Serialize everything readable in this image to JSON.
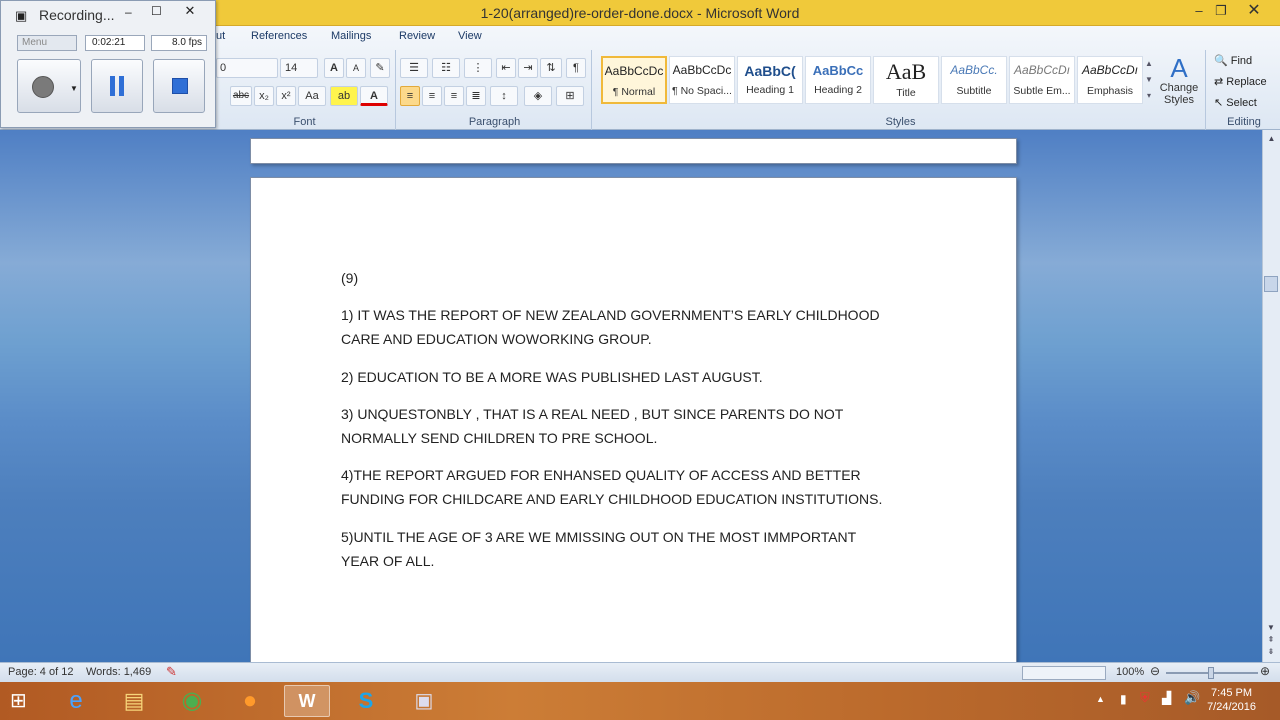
{
  "window": {
    "title": "1-20(arranged)re-order-done.docx - Microsoft Word",
    "minimize": "–",
    "maximize": "❐",
    "close": "✕"
  },
  "recorder": {
    "title": "Recording...",
    "menu": "Menu",
    "time": "0:02:21",
    "fps": "8.0 fps"
  },
  "ribbon": {
    "tabs": [
      "ut",
      "References",
      "Mailings",
      "Review",
      "View"
    ],
    "font": {
      "name": "0",
      "size": "14",
      "label": "Font"
    },
    "paragraph": {
      "label": "Paragraph"
    },
    "styles": {
      "label": "Styles",
      "items": [
        {
          "preview": "AaBbCcDc",
          "name": "¶ Normal"
        },
        {
          "preview": "AaBbCcDc",
          "name": "¶ No Spaci..."
        },
        {
          "preview": "AaBbC(",
          "name": "Heading 1"
        },
        {
          "preview": "AaBbCc",
          "name": "Heading 2"
        },
        {
          "preview": "AaB",
          "name": "Title"
        },
        {
          "preview": "AaBbCc.",
          "name": "Subtitle"
        },
        {
          "preview": "AaBbCcDı",
          "name": "Subtle Em..."
        },
        {
          "preview": "AaBbCcDı",
          "name": "Emphasis"
        }
      ],
      "change_styles": "Change Styles"
    },
    "editing": {
      "label": "Editing",
      "find": "Find",
      "replace": "Replace",
      "select": "Select"
    }
  },
  "document": {
    "lines": [
      "(9)",
      "1) IT WAS THE REPORT OF NEW  ZEALAND  GOVERNMENT’S EARLY  CHILDHOOD",
      "CARE  AND EDUCATION   WOWORKING GROUP.",
      "2) EDUCATION TO BE A MORE  WAS PUBLISHED LAST AUGUST.",
      "3) UNQUESTONBLY , THAT IS A REAL NEED , BUT SINCE PARENTS  DO NOT",
      "NORMALLY  SEND  CHILDREN TO PRE SCHOOL.",
      "4)THE REPORT ARGUED FOR  ENHANSED QUALITY OF ACCESS AND BETTER",
      "FUNDING FOR CHILDCARE  AND EARLY CHILDHOOD  EDUCATION INSTITUTIONS.",
      "5)UNTIL THE AGE OF 3  ARE  WE MMISSING OUT ON THE MOST  IMMPORTANT",
      "YEAR OF ALL."
    ]
  },
  "status": {
    "page": "Page: 4 of 12",
    "words": "Words: 1,469",
    "zoom": "100%"
  },
  "taskbar": {
    "time": "7:45 PM",
    "date": "7/24/2016"
  },
  "colors": {
    "titlebar": "#f0c93a",
    "ribbon": "#dde7f3",
    "accent_selected": "#f0b93a"
  }
}
